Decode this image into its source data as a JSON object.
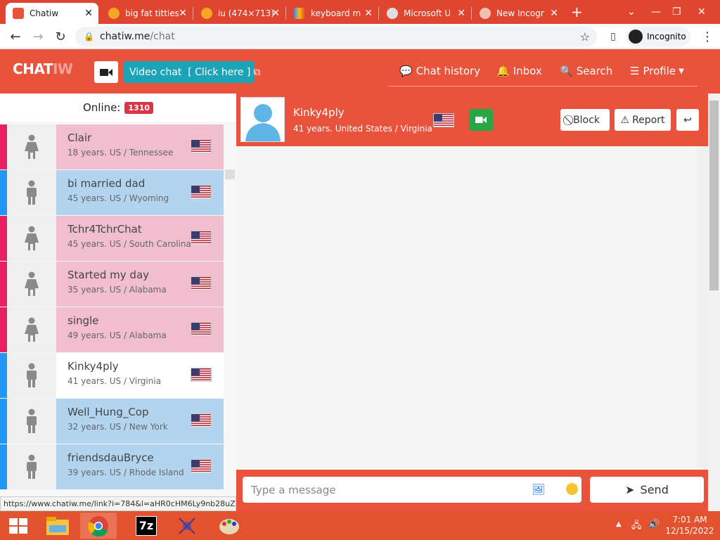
{
  "browser": {
    "tabs": [
      {
        "title": "Chatiw",
        "active": true
      },
      {
        "title": "big fat titties"
      },
      {
        "title": "iu (474×713)"
      },
      {
        "title": "keyboard m"
      },
      {
        "title": "Microsoft U"
      },
      {
        "title": "New Incogn"
      }
    ],
    "url_domain": "chatiw.me",
    "url_path": "/chat",
    "incognito_label": "Incognito",
    "status_url": "https://www.chatiw.me/link?i=784&l=aHR0cHM6Ly9nb28uZ..."
  },
  "header": {
    "logo": "CHAT",
    "logo_suffix": "IW",
    "video_chat_label": "Video chat  [ Click here ]",
    "nav": {
      "chat_history": "Chat history",
      "inbox": "Inbox",
      "search": "Search",
      "profile": "Profile"
    }
  },
  "sidebar": {
    "online_label": "Online:",
    "online_count": "1310",
    "users": [
      {
        "name": "Clair",
        "info": "18 years. US / Tennessee",
        "gender": "female"
      },
      {
        "name": "bi married dad",
        "info": "45 years. US / Wyoming",
        "gender": "male"
      },
      {
        "name": "Tchr4TchrChat",
        "info": "45 years. US / South Carolina",
        "gender": "female"
      },
      {
        "name": "Started my day",
        "info": "35 years. US / Alabama",
        "gender": "female"
      },
      {
        "name": "single",
        "info": "49 years. US / Alabama",
        "gender": "female"
      },
      {
        "name": "Kinky4ply",
        "info": "41 years. US / Virginia",
        "gender": "male",
        "selected": true
      },
      {
        "name": "Well_Hung_Cop",
        "info": "32 years. US / New York",
        "gender": "male"
      },
      {
        "name": "friendsdauBryce",
        "info": "39 years. US / Rhode Island",
        "gender": "male"
      }
    ]
  },
  "chat": {
    "name": "Kinky4ply",
    "info": "41 years. United States / Virginia",
    "block_label": "Block",
    "report_label": "Report",
    "message_placeholder": "Type a message",
    "send_label": "Send"
  },
  "taskbar": {
    "time": "7:01 AM",
    "date": "12/15/2022"
  },
  "colors": {
    "brand": "#e9523b",
    "female_card": "#f1bed0",
    "male_card": "#b3d4ef",
    "female_stripe": "#e91e63",
    "male_stripe": "#2196f3"
  }
}
